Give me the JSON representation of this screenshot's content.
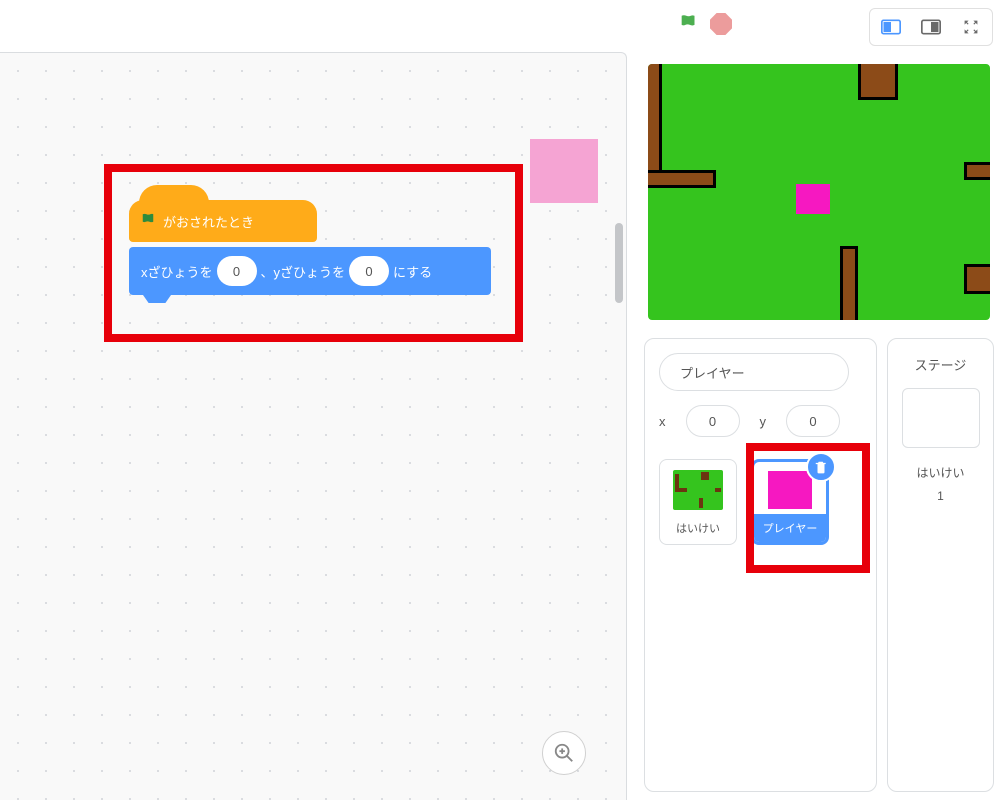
{
  "toolbar": {
    "green_flag": "green-flag",
    "stop": "stop"
  },
  "script": {
    "hat_label": "がおされたとき",
    "goto_prefix_x": "xざひょうを",
    "goto_x_value": "0",
    "goto_middle": "、yざひょうを",
    "goto_y_value": "0",
    "goto_suffix": "にする"
  },
  "sprite_info": {
    "name": "プレイヤー",
    "x_label": "x",
    "x_value": "0",
    "y_label": "y",
    "y_value": "0"
  },
  "sprites": [
    {
      "label": "はいけい",
      "selected": false
    },
    {
      "label": "プレイヤー",
      "selected": true
    }
  ],
  "stage": {
    "title": "ステージ",
    "backdrop_label": "はいけい",
    "backdrop_count": "1"
  }
}
